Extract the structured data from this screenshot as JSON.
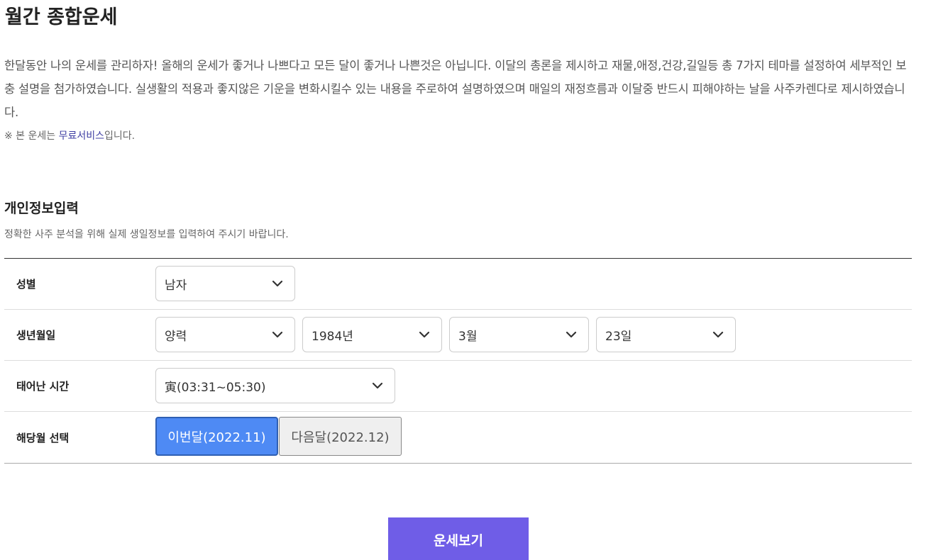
{
  "page": {
    "title": "월간 종합운세",
    "intro": "한달동안 나의 운세를 관리하자! 올해의 운세가 좋거나 나쁘다고 모든 달이 좋거나 나쁜것은 아닙니다. 이달의 총론을 제시하고 재물,애정,건강,길일등 총 7가지 테마를 설정하여 세부적인 보충 설명을 첨가하였습니다. 실생활의 적용과 좋지않은 기운을 변화시킬수 있는 내용을 주로하여 설명하였으며 매일의 재정흐름과 이달중 반드시 피해야하는 날을 사주카렌다로 제시하였습니다.",
    "notice_prefix": "※ 본 운세는 ",
    "notice_link": "무료서비스",
    "notice_suffix": "입니다."
  },
  "form": {
    "title": "개인정보입력",
    "description": "정확한 사주 분석을 위해 실제 생일정보를 입력하여 주시기 바랍니다.",
    "gender": {
      "label": "성별",
      "value": "남자"
    },
    "birth": {
      "label": "생년월일",
      "calendar": "양력",
      "year": "1984년",
      "month": "3월",
      "day": "23일"
    },
    "birth_time": {
      "label": "태어난 시간",
      "value": "寅(03:31~05:30)"
    },
    "month_select": {
      "label": "해당월 선택",
      "options": [
        {
          "label": "이번달(2022.11)",
          "selected": true
        },
        {
          "label": "다음달(2022.12)",
          "selected": false
        }
      ]
    }
  },
  "submit_label": "운세보기",
  "colors": {
    "accent_blue": "#4e8af4",
    "submit_purple": "#6f5de7",
    "link": "#3f3fa3"
  },
  "icons": {
    "select_arrow": "chevron-down-icon"
  }
}
